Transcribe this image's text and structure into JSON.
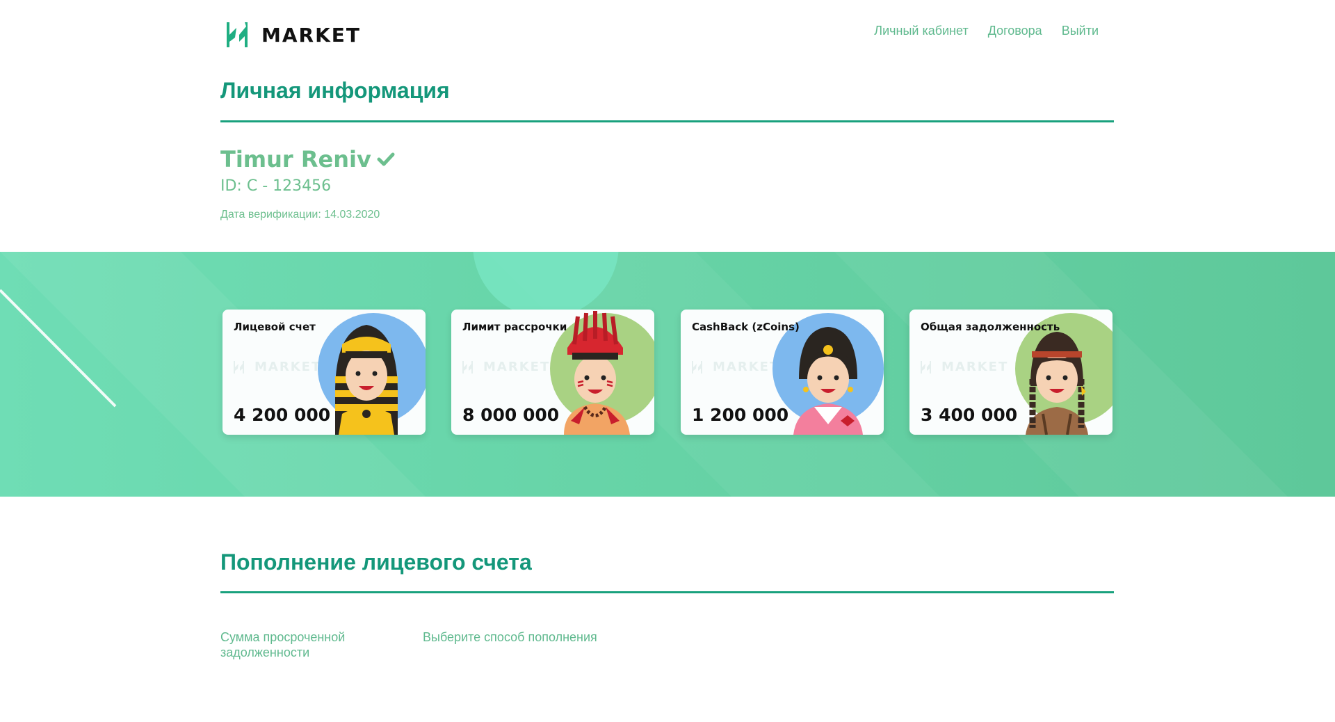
{
  "header": {
    "logo_text": "MARKET",
    "nav": [
      "Личный кабинет",
      "Договора",
      "Выйти"
    ]
  },
  "personal": {
    "title": "Личная информация",
    "name": "Timur Reniv",
    "id": "ID: C - 123456",
    "verification": "Дата верификации: 14.03.2020"
  },
  "cards": [
    {
      "title": "Лицевой счет",
      "value": "4 200 000",
      "watermark": "MARKET",
      "accent": "#7db8ee"
    },
    {
      "title": "Лимит рассрочки",
      "value": "8 000 000",
      "watermark": "MARKET",
      "accent": "#a9d283"
    },
    {
      "title": "CashBack (zCoins)",
      "value": "1 200 000",
      "watermark": "MARKET",
      "accent": "#7db8ee"
    },
    {
      "title": "Общая задолженность",
      "value": "3 400 000",
      "watermark": "MARKET",
      "accent": "#a9d283"
    }
  ],
  "topup": {
    "title": "Пополнение лицевого счета",
    "overdue_label": "Сумма просроченной задолженности",
    "method_label": "Выберите способ пополнения"
  },
  "colors": {
    "brand_green": "#14977a",
    "light_green": "#6cbf8e",
    "band": "#66d3a6"
  }
}
